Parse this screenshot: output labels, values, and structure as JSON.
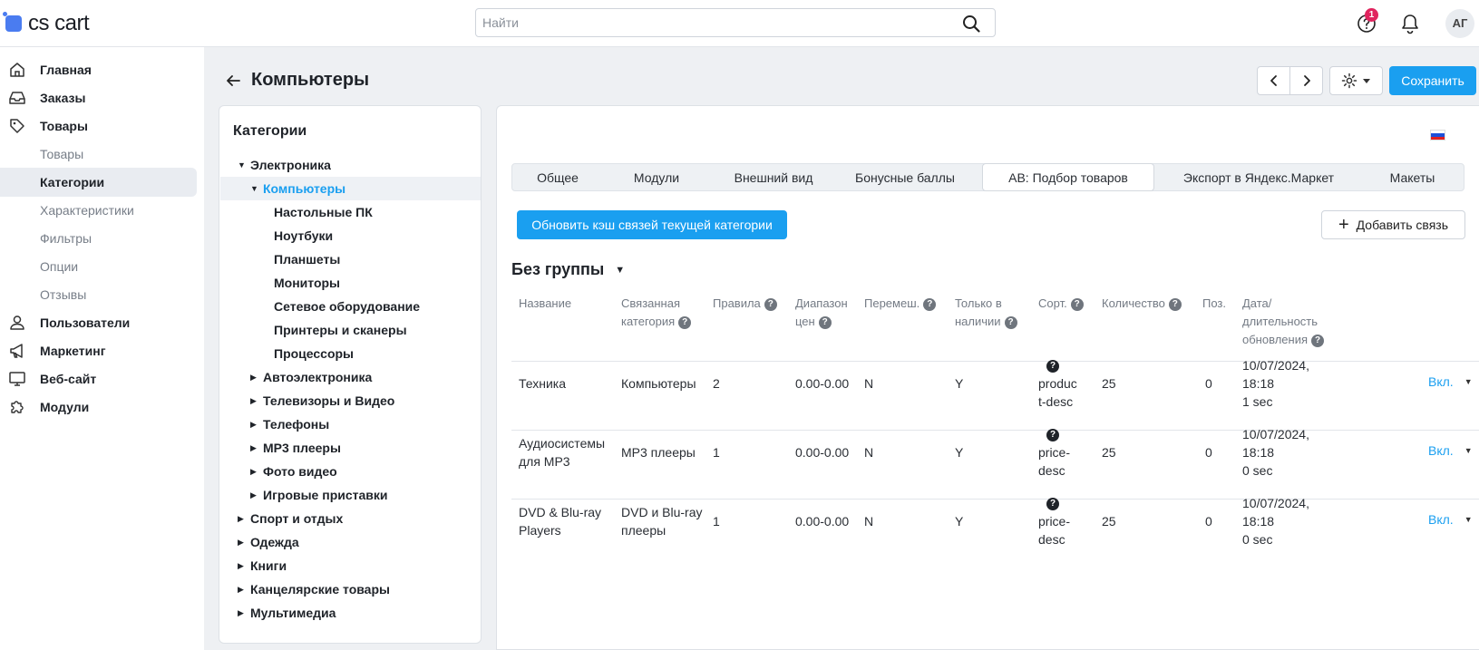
{
  "app": {
    "logo": "cs cart"
  },
  "header": {
    "search_placeholder": "Найти",
    "help_badge": "1",
    "avatar_initials": "АГ"
  },
  "sidebar": {
    "items": [
      {
        "label": "Главная",
        "icon": "home-icon"
      },
      {
        "label": "Заказы",
        "icon": "inbox-icon"
      },
      {
        "label": "Товары",
        "icon": "tag-icon"
      },
      {
        "label": "Товары",
        "sub": true
      },
      {
        "label": "Категории",
        "sub": true,
        "active": true
      },
      {
        "label": "Характеристики",
        "sub": true
      },
      {
        "label": "Фильтры",
        "sub": true
      },
      {
        "label": "Опции",
        "sub": true
      },
      {
        "label": "Отзывы",
        "sub": true
      },
      {
        "label": "Пользователи",
        "icon": "user-icon"
      },
      {
        "label": "Маркетинг",
        "icon": "megaphone-icon"
      },
      {
        "label": "Веб-сайт",
        "icon": "monitor-icon"
      },
      {
        "label": "Модули",
        "icon": "puzzle-icon"
      }
    ]
  },
  "page": {
    "title": "Компьютеры",
    "save_label": "Сохранить"
  },
  "categories": {
    "title": "Категории",
    "tree": [
      {
        "label": "Электроника",
        "level": 0,
        "caret": "down"
      },
      {
        "label": "Компьютеры",
        "level": 1,
        "caret": "down",
        "active": true
      },
      {
        "label": "Настольные ПК",
        "level": 2
      },
      {
        "label": "Ноутбуки",
        "level": 2
      },
      {
        "label": "Планшеты",
        "level": 2
      },
      {
        "label": "Мониторы",
        "level": 2
      },
      {
        "label": "Сетевое оборудование",
        "level": 2
      },
      {
        "label": "Принтеры и сканеры",
        "level": 2
      },
      {
        "label": "Процессоры",
        "level": 2
      },
      {
        "label": "Автоэлектроника",
        "level": 1,
        "caret": "right"
      },
      {
        "label": "Телевизоры и Видео",
        "level": 1,
        "caret": "right"
      },
      {
        "label": "Телефоны",
        "level": 1,
        "caret": "right"
      },
      {
        "label": "MP3 плееры",
        "level": 1,
        "caret": "right"
      },
      {
        "label": "Фото видео",
        "level": 1,
        "caret": "right"
      },
      {
        "label": "Игровые приставки",
        "level": 1,
        "caret": "right"
      },
      {
        "label": "Спорт и отдых",
        "level": 0,
        "caret": "right"
      },
      {
        "label": "Одежда",
        "level": 0,
        "caret": "right"
      },
      {
        "label": "Книги",
        "level": 0,
        "caret": "right"
      },
      {
        "label": "Канцелярские товары",
        "level": 0,
        "caret": "right"
      },
      {
        "label": "Мультимедиа",
        "level": 0,
        "caret": "right"
      }
    ]
  },
  "tabs": [
    {
      "label": "Общее"
    },
    {
      "label": "Модули"
    },
    {
      "label": "Внешний вид"
    },
    {
      "label": "Бонусные баллы"
    },
    {
      "label": "AB: Подбор товаров",
      "active": true
    },
    {
      "label": "Экспорт в Яндекс.Маркет"
    },
    {
      "label": "Макеты"
    }
  ],
  "actions": {
    "refresh_label": "Обновить кэш связей текущей категории",
    "add_link_label": "Добавить связь"
  },
  "group": {
    "title": "Без группы"
  },
  "table": {
    "headers": {
      "name": "Название",
      "linked_category": "Связанная категория",
      "rules": "Правила",
      "price_range": "Диапазон цен",
      "shuffle": "Перемеш.",
      "in_stock": "Только в наличии",
      "sort": "Сорт.",
      "amount": "Количество",
      "position": "Поз.",
      "updated": "Дата/ длительность обновления"
    },
    "rows": [
      {
        "name": "Техника",
        "linked_category": "Компьютеры",
        "rules": "2",
        "price_range": "0.00-0.00",
        "shuffle": "N",
        "in_stock": "Y",
        "sort": "product-desc",
        "amount": "25",
        "position": "0",
        "updated_date": "10/07/2024,",
        "updated_time": "18:18",
        "duration": "1 sec",
        "status": "Вкл."
      },
      {
        "name": "Аудиосистемы для MP3",
        "linked_category": "MP3 плееры",
        "rules": "1",
        "price_range": "0.00-0.00",
        "shuffle": "N",
        "in_stock": "Y",
        "sort": "price-desc",
        "amount": "25",
        "position": "0",
        "updated_date": "10/07/2024,",
        "updated_time": "18:18",
        "duration": "0 sec",
        "status": "Вкл."
      },
      {
        "name": "DVD & Blu-ray Players",
        "linked_category": "DVD и Blu-ray плееры",
        "rules": "1",
        "price_range": "0.00-0.00",
        "shuffle": "N",
        "in_stock": "Y",
        "sort": "price-desc",
        "amount": "25",
        "position": "0",
        "updated_date": "10/07/2024,",
        "updated_time": "18:18",
        "duration": "0 sec",
        "status": "Вкл."
      }
    ]
  },
  "colors": {
    "accent": "#1a9ff0",
    "badge": "#e0245e",
    "logo": "#4a7cf0"
  }
}
